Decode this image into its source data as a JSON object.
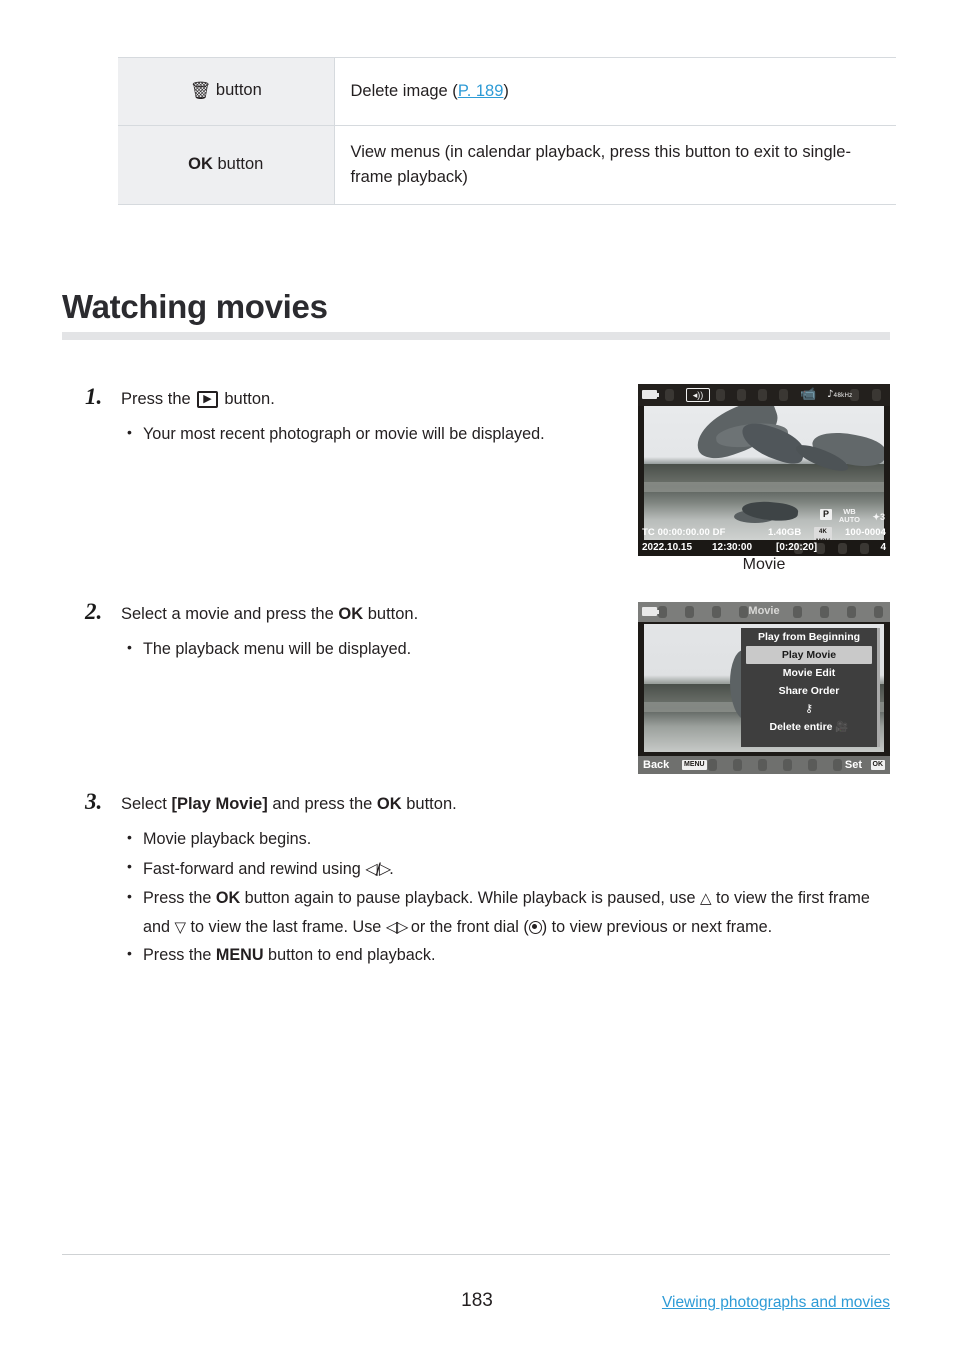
{
  "reference_table": {
    "rows": [
      {
        "key_icon": "trash-icon",
        "key_glyph": "🗑",
        "key_label": "button",
        "description_prefix": "Delete image (",
        "description_link": "P. 189",
        "description_suffix": ")"
      },
      {
        "key_icon": "ok-button",
        "key_bold": "OK",
        "key_label": "button",
        "description": "View menus (in calendar playback, press this button to exit to single-frame playback)"
      }
    ]
  },
  "heading": {
    "title": "Watching movies"
  },
  "steps": [
    {
      "number": "1.",
      "lead_before": "Press the",
      "lead_icon": "playback-button-icon",
      "lead_icon_glyph": "▶",
      "lead_after": "button.",
      "bullets": [
        "Your most recent photograph or movie will be displayed."
      ]
    },
    {
      "number": "2.",
      "lead_before": "Select a movie and press the",
      "lead_bold": "OK",
      "lead_after": "button.",
      "bullets": [
        "The playback menu will be displayed."
      ]
    },
    {
      "number": "3.",
      "lead_before": "Select",
      "lead_bracket": "[Play Movie]",
      "lead_mid": "and press the",
      "lead_bold": "OK",
      "lead_after": "button.",
      "bullets_rich": [
        {
          "id": "b1",
          "text": "Movie playback begins."
        },
        {
          "id": "b2",
          "t1": "Fast-forward and rewind using ",
          "arrows": "◁/▷",
          "t2": "."
        },
        {
          "id": "b3",
          "p1": "Press the ",
          "bold1": "OK",
          "p2": " button again to pause playback. While playback is paused, use ",
          "up": "△",
          "p3": " to view the first frame and ",
          "down": "▽",
          "p4": " to view the last frame. Use ",
          "lr": "◁▷",
          "p5": " or the front dial (",
          "dial": "front-dial-icon",
          "p6": ") to view previous or next frame."
        },
        {
          "id": "b4",
          "p1": "Press the ",
          "bold1": "MENU",
          "p2": " button to end playback."
        }
      ]
    }
  ],
  "lcd_playback": {
    "battery_icon": "battery-icon",
    "speaker_icon": "speaker-volume-icon",
    "speaker_glyph": "◂))",
    "movie_icon": "movie-camera-icon",
    "movie_glyph": "🎥",
    "audio_icon": "audio-sample-rate-icon",
    "audio_glyph": "♪",
    "audio_rate": "48kHz",
    "mode": "P",
    "wb_line1": "WB",
    "wb_line2": "AUTO",
    "is_indicator": "S-IS 3",
    "timecode": "TC 00:00:00.00 DF",
    "file_size": "1.40GB",
    "format_chip": "4K\nMOV",
    "file_number": "100-0004",
    "date": "2022.10.15",
    "time": "12:30:00",
    "duration": "[0:20:20]",
    "frame_number": "4",
    "caption": "Movie"
  },
  "lcd_menu": {
    "battery_icon": "battery-icon",
    "title": "Movie",
    "items": [
      {
        "label": "Play from Beginning",
        "selected": false
      },
      {
        "label": "Play Movie",
        "selected": true
      },
      {
        "label": "Movie Edit",
        "selected": false
      },
      {
        "label": "Share Order",
        "selected": false
      },
      {
        "label": "⚷",
        "selected": false,
        "icon": "protect-key-icon"
      },
      {
        "label": "Delete entire 🎥",
        "selected": false
      }
    ],
    "footer_back": "Back",
    "footer_back_chip": "MENU",
    "footer_set": "Set",
    "footer_set_chip": "OK"
  },
  "footer": {
    "page_number": "183",
    "section_link": "Viewing photographs and movies"
  },
  "colors": {
    "link": "#2e9bd6",
    "table_key_bg": "#eeeff1",
    "rule": "#e3e4e6",
    "text": "#231f20"
  }
}
